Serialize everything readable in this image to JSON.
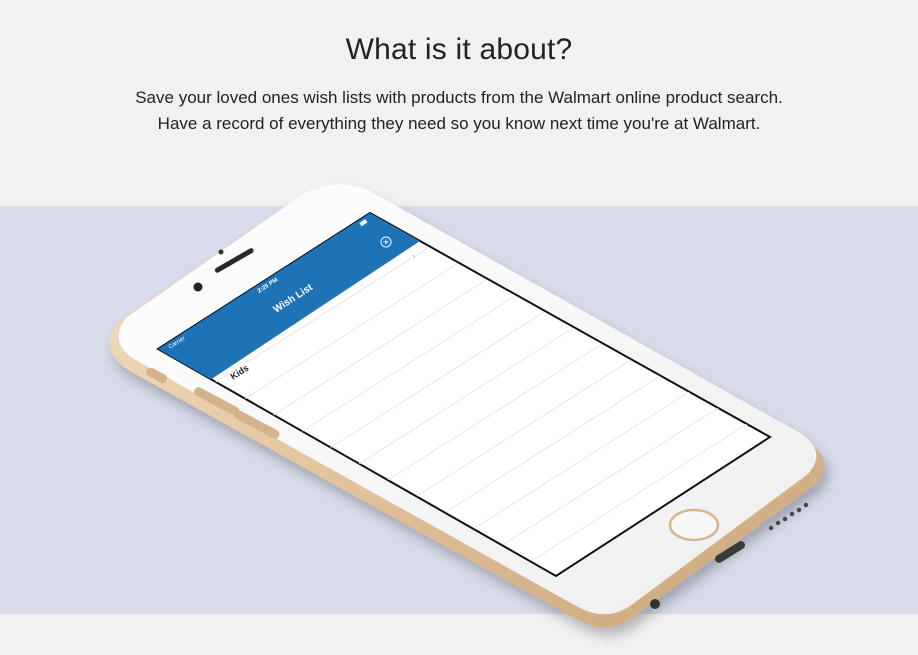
{
  "intro": {
    "heading": "What is it about?",
    "line1": "Save your loved ones wish lists with products from the Walmart online product search.",
    "line2": "Have a record of everything they need so you know next time you're at Walmart."
  },
  "phone_screen": {
    "carrier": "Carrier",
    "time": "2:25 PM",
    "nav_title": "Wish List",
    "add_icon": "plus-circle-icon",
    "list_items": [
      "Kids"
    ]
  },
  "colors": {
    "page_bg": "#f1f1f1",
    "band_bg": "#d7dbea",
    "nav_blue": "#1e73b7",
    "phone_gold": "#e6c9a3"
  }
}
